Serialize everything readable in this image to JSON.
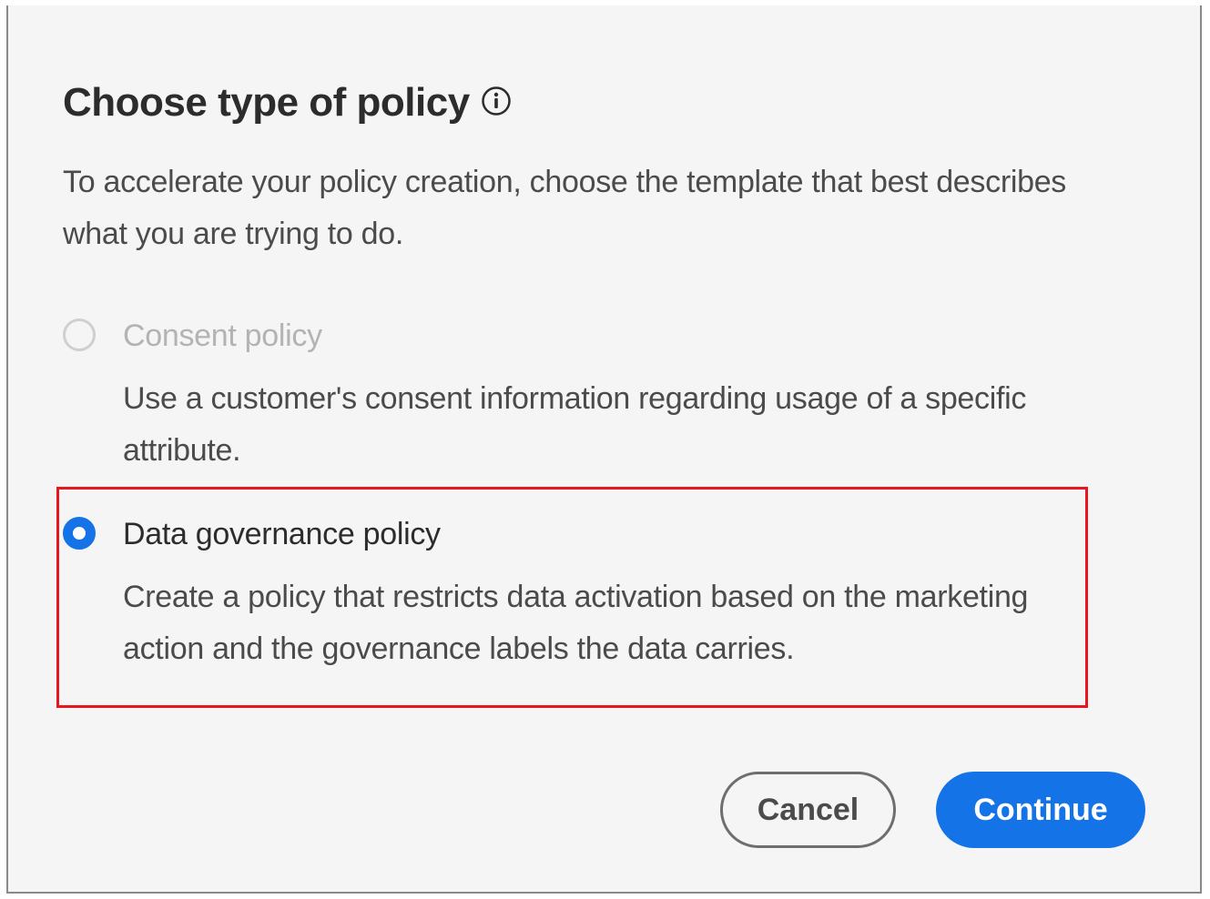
{
  "dialog": {
    "title": "Choose type of policy",
    "intro": "To accelerate your policy creation, choose the template that best describes what you are trying to do.",
    "options": [
      {
        "label": "Consent policy",
        "description": "Use a customer's consent information regarding usage of a specific attribute.",
        "selected": false,
        "disabled": true
      },
      {
        "label": "Data governance policy",
        "description": "Create a policy that restricts data activation based on the marketing action and the governance labels the data carries.",
        "selected": true,
        "disabled": false
      }
    ],
    "cancel_label": "Cancel",
    "continue_label": "Continue"
  },
  "colors": {
    "accent": "#1473e6",
    "highlight": "#e8161e",
    "background": "#f5f5f5"
  },
  "icons": {
    "info": "info-icon"
  }
}
